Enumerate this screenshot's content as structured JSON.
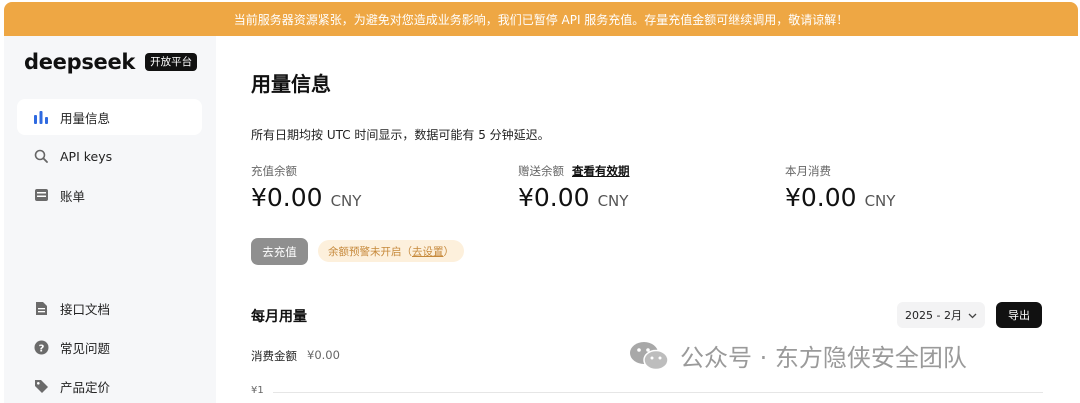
{
  "banner": {
    "text": "当前服务器资源紧张，为避免对您造成业务影响，我们已暂停 API 服务充值。存量充值金额可继续调用，敬请谅解！"
  },
  "sidebar": {
    "logo_text": "deepseek",
    "logo_badge": "开放平台",
    "items": [
      {
        "label": "用量信息",
        "icon": "bar-chart-icon"
      },
      {
        "label": "API keys",
        "icon": "search-icon"
      },
      {
        "label": "账单",
        "icon": "bill-icon"
      },
      {
        "label": "接口文档",
        "icon": "document-icon"
      },
      {
        "label": "常见问题",
        "icon": "question-icon"
      },
      {
        "label": "产品定价",
        "icon": "tag-icon"
      }
    ]
  },
  "main": {
    "title": "用量信息",
    "note": "所有日期均按 UTC 时间显示，数据可能有 5 分钟延迟。",
    "stats": [
      {
        "label": "充值余额",
        "amount": "¥0.00",
        "unit": "CNY"
      },
      {
        "label": "赠送余额",
        "link": "查看有效期",
        "amount": "¥0.00",
        "unit": "CNY"
      },
      {
        "label": "本月消费",
        "amount": "¥0.00",
        "unit": "CNY"
      }
    ],
    "recharge_label": "去充值",
    "alert_text": "余额预警未开启（",
    "alert_link": "去设置",
    "alert_end": "）",
    "section_title": "每月用量",
    "month_value": "2025 - 2月",
    "export_label": "导出",
    "spend_label": "消费金额",
    "spend_value": "¥0.00",
    "axis_tick": "¥1"
  },
  "watermark": {
    "text": "公众号 · 东方隐侠安全团队",
    "icon": "wechat-icon"
  },
  "colors": {
    "banner": "#eea744",
    "alert_bg": "#fdf0dc",
    "alert_text": "#c6893b",
    "active_icon": "#2f6ae0"
  }
}
